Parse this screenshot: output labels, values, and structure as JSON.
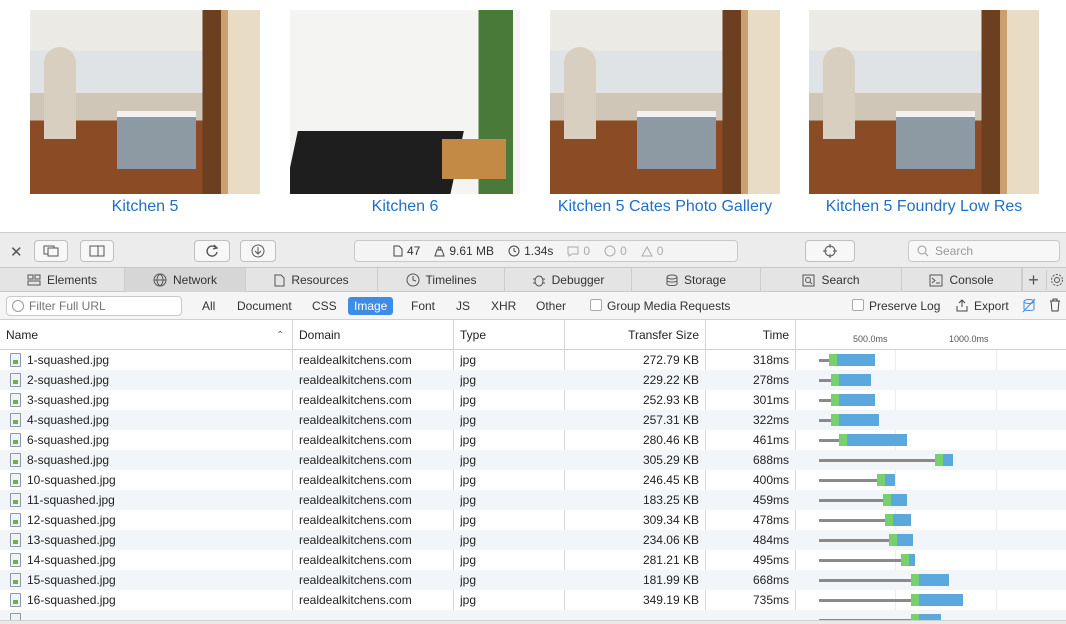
{
  "gallery": [
    {
      "caption": "Kitchen 5",
      "image": "kitchen-photo"
    },
    {
      "caption": "Kitchen 6",
      "image": "kitchen-photo"
    },
    {
      "caption": "Kitchen 5 Cates Photo Gallery",
      "image": "kitchen-photo"
    },
    {
      "caption": "Kitchen 5 Foundry Low Res",
      "image": "kitchen-photo"
    }
  ],
  "toolbar": {
    "resource_count": "47",
    "transfer_size": "9.61 MB",
    "load_time": "1.34s",
    "messages_count": "0",
    "errors_count": "0",
    "warnings_count": "0",
    "search_placeholder": "Search"
  },
  "tabs": [
    {
      "label": "Elements",
      "icon": "elements-icon"
    },
    {
      "label": "Network",
      "icon": "network-icon",
      "active": true
    },
    {
      "label": "Resources",
      "icon": "resources-icon"
    },
    {
      "label": "Timelines",
      "icon": "timelines-icon"
    },
    {
      "label": "Debugger",
      "icon": "debugger-icon"
    },
    {
      "label": "Storage",
      "icon": "storage-icon"
    },
    {
      "label": "Search",
      "icon": "search-icon"
    },
    {
      "label": "Console",
      "icon": "console-icon"
    }
  ],
  "filter": {
    "placeholder": "Filter Full URL",
    "types": [
      "All",
      "Document",
      "CSS",
      "Image",
      "Font",
      "JS",
      "XHR",
      "Other"
    ],
    "active_type": "Image",
    "group_media_label": "Group Media Requests",
    "preserve_log_label": "Preserve Log",
    "export_label": "Export"
  },
  "table": {
    "headers": {
      "name": "Name",
      "domain": "Domain",
      "type": "Type",
      "transfer_size": "Transfer Size",
      "time": "Time"
    },
    "timeline_ticks": [
      "500.0ms",
      "1000.0ms"
    ],
    "rows": [
      {
        "name": "1-squashed.jpg",
        "domain": "realdealkitchens.com",
        "type": "jpg",
        "size": "272.79 KB",
        "time": "318ms",
        "start": 0.0,
        "wait": 0.09,
        "recv": 0.21
      },
      {
        "name": "2-squashed.jpg",
        "domain": "realdealkitchens.com",
        "type": "jpg",
        "size": "229.22 KB",
        "time": "278ms",
        "start": 0.0,
        "wait": 0.1,
        "recv": 0.18
      },
      {
        "name": "3-squashed.jpg",
        "domain": "realdealkitchens.com",
        "type": "jpg",
        "size": "252.93 KB",
        "time": "301ms",
        "start": 0.0,
        "wait": 0.1,
        "recv": 0.2
      },
      {
        "name": "4-squashed.jpg",
        "domain": "realdealkitchens.com",
        "type": "jpg",
        "size": "257.31 KB",
        "time": "322ms",
        "start": 0.0,
        "wait": 0.1,
        "recv": 0.22
      },
      {
        "name": "6-squashed.jpg",
        "domain": "realdealkitchens.com",
        "type": "jpg",
        "size": "280.46 KB",
        "time": "461ms",
        "start": 0.0,
        "wait": 0.14,
        "recv": 0.32
      },
      {
        "name": "8-squashed.jpg",
        "domain": "realdealkitchens.com",
        "type": "jpg",
        "size": "305.29 KB",
        "time": "688ms",
        "start": 0.0,
        "wait": 0.62,
        "recv": 0.07
      },
      {
        "name": "10-squashed.jpg",
        "domain": "realdealkitchens.com",
        "type": "jpg",
        "size": "246.45 KB",
        "time": "400ms",
        "start": 0.0,
        "wait": 0.33,
        "recv": 0.07
      },
      {
        "name": "11-squashed.jpg",
        "domain": "realdealkitchens.com",
        "type": "jpg",
        "size": "183.25 KB",
        "time": "459ms",
        "start": 0.0,
        "wait": 0.36,
        "recv": 0.1
      },
      {
        "name": "12-squashed.jpg",
        "domain": "realdealkitchens.com",
        "type": "jpg",
        "size": "309.34 KB",
        "time": "478ms",
        "start": 0.0,
        "wait": 0.37,
        "recv": 0.11
      },
      {
        "name": "13-squashed.jpg",
        "domain": "realdealkitchens.com",
        "type": "jpg",
        "size": "234.06 KB",
        "time": "484ms",
        "start": 0.0,
        "wait": 0.39,
        "recv": 0.1
      },
      {
        "name": "14-squashed.jpg",
        "domain": "realdealkitchens.com",
        "type": "jpg",
        "size": "281.21 KB",
        "time": "495ms",
        "start": 0.0,
        "wait": 0.45,
        "recv": 0.05
      },
      {
        "name": "15-squashed.jpg",
        "domain": "realdealkitchens.com",
        "type": "jpg",
        "size": "181.99 KB",
        "time": "668ms",
        "start": 0.0,
        "wait": 0.5,
        "recv": 0.17
      },
      {
        "name": "16-squashed.jpg",
        "domain": "realdealkitchens.com",
        "type": "jpg",
        "size": "349.19 KB",
        "time": "735ms",
        "start": 0.0,
        "wait": 0.5,
        "recv": 0.24
      },
      {
        "name": "",
        "domain": "",
        "type": "",
        "size": "",
        "time": "",
        "start": 0.0,
        "wait": 0.5,
        "recv": 0.13
      }
    ]
  },
  "colors": {
    "accent": "#3d8ce5",
    "link": "#1f6fc7",
    "waiting": "#78cf6e",
    "receiving": "#5aa8de",
    "queue": "#8a8a8a"
  }
}
